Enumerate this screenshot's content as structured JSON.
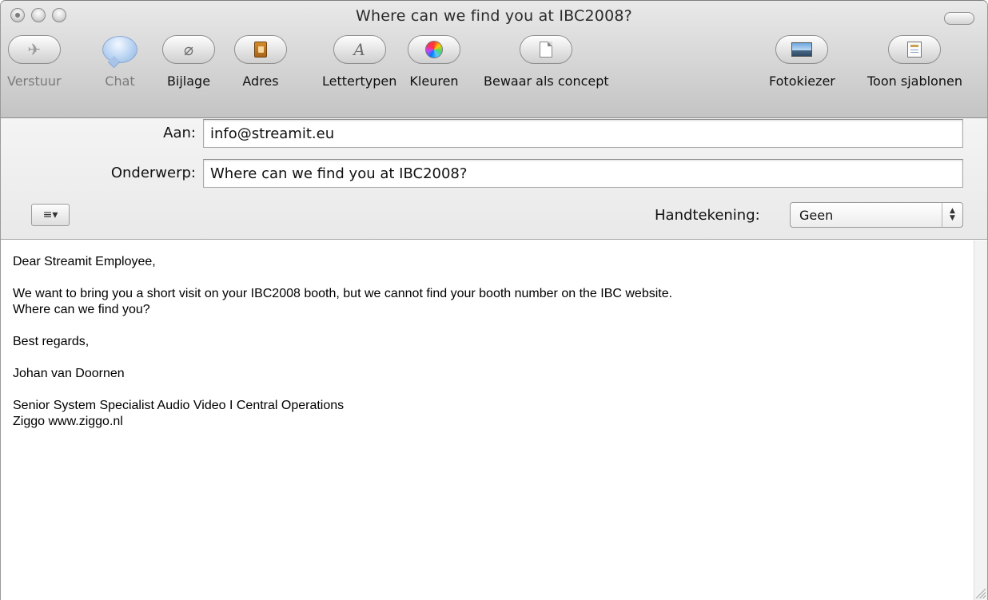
{
  "window": {
    "title": "Where can we find you at IBC2008?"
  },
  "toolbar": {
    "items": [
      {
        "label": "Verstuur",
        "icon": "send-plane-icon",
        "enabled": false
      },
      {
        "label": "Chat",
        "icon": "chat-bubble-icon",
        "enabled": false
      },
      {
        "label": "Bijlage",
        "icon": "paperclip-icon",
        "enabled": true
      },
      {
        "label": "Adres",
        "icon": "address-book-icon",
        "enabled": true
      },
      {
        "label": "Lettertypen",
        "icon": "font-icon",
        "enabled": true
      },
      {
        "label": "Kleuren",
        "icon": "color-wheel-icon",
        "enabled": true
      },
      {
        "label": "Bewaar als concept",
        "icon": "draft-document-icon",
        "enabled": true
      },
      {
        "label": "Fotokiezer",
        "icon": "photo-browser-icon",
        "enabled": true
      },
      {
        "label": "Toon sjablonen",
        "icon": "stationery-template-icon",
        "enabled": true
      }
    ],
    "font_glyph": "A",
    "paperclip_glyph": "⌀",
    "send_glyph": "✈"
  },
  "headers": {
    "to_label": "Aan:",
    "to_value": "info@streamit.eu",
    "subject_label": "Onderwerp:",
    "subject_value": "Where can we find you at IBC2008?",
    "signature_label": "Handtekening:",
    "signature_value": "Geen",
    "menu_glyph": "≡▾"
  },
  "message": {
    "greeting": "Dear Streamit Employee,",
    "para1_line1": "We want to bring you a short visit on your IBC2008 booth, but we cannot find your booth number on the IBC website.",
    "para1_line2": "Where can we find you?",
    "closing": "Best regards,",
    "name": "Johan van Doornen",
    "title_line": "Senior System Specialist Audio Video I Central Operations",
    "company_line": "Ziggo www.ziggo.nl"
  }
}
